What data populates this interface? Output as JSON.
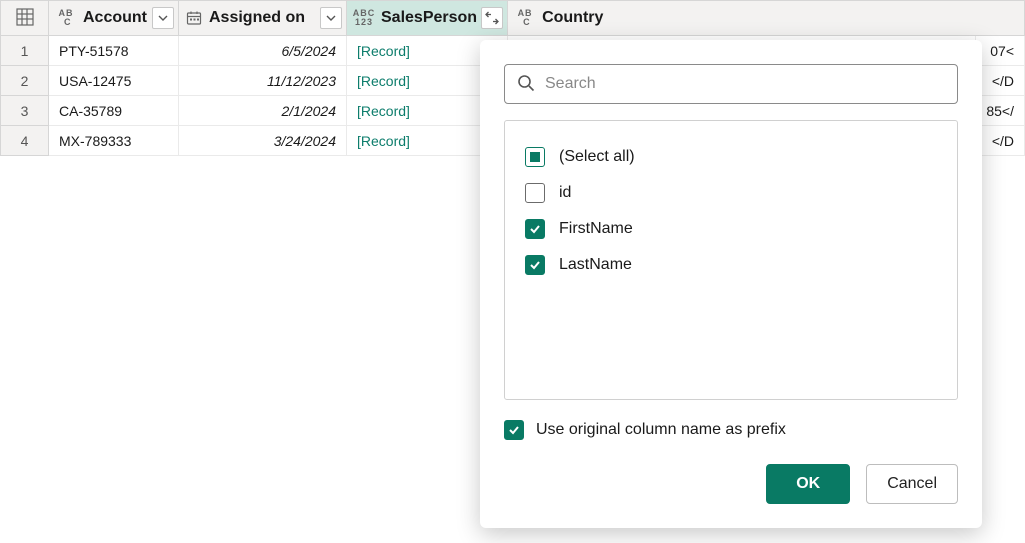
{
  "columns": {
    "account": {
      "label": "Account"
    },
    "assigned_on": {
      "label": "Assigned on"
    },
    "salesperson": {
      "label": "SalesPerson"
    },
    "country": {
      "label": "Country"
    }
  },
  "rows": [
    {
      "num": "1",
      "account": "PTY-51578",
      "assigned_on": "6/5/2024",
      "salesperson": "[Record]",
      "country_tail": "07<"
    },
    {
      "num": "2",
      "account": "USA-12475",
      "assigned_on": "11/12/2023",
      "salesperson": "[Record]",
      "country_tail": "</D"
    },
    {
      "num": "3",
      "account": "CA-35789",
      "assigned_on": "2/1/2024",
      "salesperson": "[Record]",
      "country_tail": "85</"
    },
    {
      "num": "4",
      "account": "MX-789333",
      "assigned_on": "3/24/2024",
      "salesperson": "[Record]",
      "country_tail": "</D"
    }
  ],
  "popup": {
    "search_placeholder": "Search",
    "options": [
      {
        "label": "(Select all)",
        "state": "indeterminate"
      },
      {
        "label": "id",
        "state": "unchecked"
      },
      {
        "label": "FirstName",
        "state": "checked"
      },
      {
        "label": "LastName",
        "state": "checked"
      }
    ],
    "prefix_label": "Use original column name as prefix",
    "ok_label": "OK",
    "cancel_label": "Cancel"
  }
}
